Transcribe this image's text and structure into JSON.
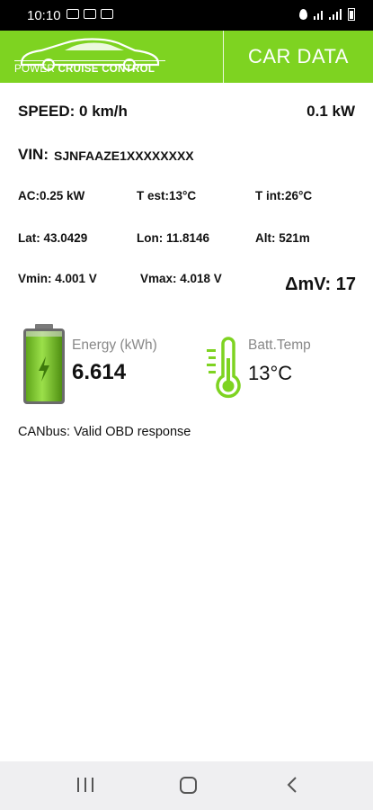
{
  "status_bar": {
    "time": "10:10"
  },
  "header": {
    "brand_regular": "POWER ",
    "brand_bold": "CRUISE CONTROL",
    "car_data_label": "CAR DATA",
    "accent_color": "#7ed321"
  },
  "car": {
    "speed": "SPEED: 0 km/h",
    "power": "0.1 kW",
    "vin_label": "VIN:",
    "vin_value": "SJNFAAZE1XXXXXXXX",
    "ac": "AC:0.25 kW",
    "t_est": "T est:13°C",
    "t_int": "T int:26°C",
    "lat": "Lat: 43.0429",
    "lon": "Lon: 11.8146",
    "alt": "Alt: 521m",
    "vmin": "Vmin: 4.001 V",
    "vmax": "Vmax: 4.018 V",
    "delta_mv": "ΔmV: 17"
  },
  "energy": {
    "label": "Energy (kWh)",
    "value": "6.614",
    "icon": "battery-charging-icon"
  },
  "battery_temp": {
    "label": "Batt.Temp",
    "value": "13°C",
    "icon": "thermometer-icon"
  },
  "canbus_status": "CANbus: Valid OBD response",
  "nav": {
    "recent_icon": "recent-apps-icon",
    "home_icon": "home-icon",
    "back_icon": "back-icon"
  }
}
